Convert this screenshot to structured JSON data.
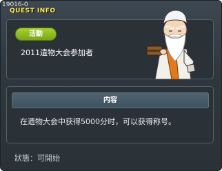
{
  "header": {
    "quest_id": "19016-0",
    "title": "QUEST INFO"
  },
  "info": {
    "badge": "活動",
    "quest_name": "2011遺物大会参加者"
  },
  "content": {
    "header": "内容",
    "description": "在遗物大会中获得5000分时，可以获得称号。"
  },
  "status": {
    "text": "狀態：可開始"
  },
  "npc": {
    "icon": "old-sage-npc-icon"
  },
  "colors": {
    "title": "#ffee55",
    "badge": "#8dbb1f",
    "panel": "#2a3137"
  }
}
